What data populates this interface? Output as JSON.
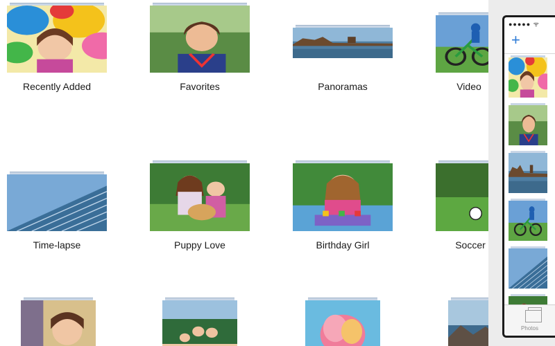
{
  "albums": [
    {
      "label": "Recently Added",
      "scene": "balloons"
    },
    {
      "label": "Favorites",
      "scene": "boy"
    },
    {
      "label": "Panoramas",
      "scene": "panorama"
    },
    {
      "label": "Video",
      "scene": "bike"
    },
    {
      "label": "Time-lapse",
      "scene": "building"
    },
    {
      "label": "Puppy Love",
      "scene": "puppy"
    },
    {
      "label": "Birthday Girl",
      "scene": "birthday"
    },
    {
      "label": "Soccer",
      "scene": "soccer"
    },
    {
      "label": "",
      "scene": "selfie"
    },
    {
      "label": "",
      "scene": "family"
    },
    {
      "label": "",
      "scene": "flower"
    },
    {
      "label": "",
      "scene": "coast"
    }
  ],
  "phone": {
    "status": "●●●●● ᯤ",
    "add_symbol": "+",
    "tab_label": "Photos",
    "thumbnails": [
      "balloons",
      "boy",
      "panorama",
      "bike",
      "building",
      "puppy"
    ]
  },
  "colors": {
    "accent": "#2d7bd6",
    "stack_edge": "#c9d6e6"
  }
}
